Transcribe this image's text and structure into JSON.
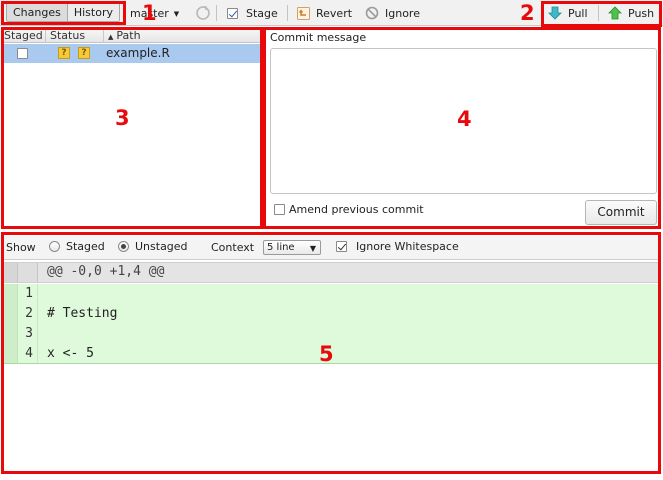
{
  "toolbar": {
    "tabs": [
      {
        "label": "Changes"
      },
      {
        "label": "History"
      }
    ],
    "branch": "master",
    "stage_label": "Stage",
    "revert_label": "Revert",
    "ignore_label": "Ignore",
    "pull_label": "Pull",
    "push_label": "Push"
  },
  "files": {
    "columns": {
      "staged": "Staged",
      "status": "Status",
      "path": "Path"
    },
    "rows": [
      {
        "staged": false,
        "status": [
          "?",
          "?"
        ],
        "path": "example.R"
      }
    ]
  },
  "commit": {
    "label": "Commit message",
    "message": "",
    "amend_label": "Amend previous commit",
    "button_label": "Commit"
  },
  "diff_options": {
    "show_label": "Show",
    "staged_label": "Staged",
    "unstaged_label": "Unstaged",
    "selected_view": "Unstaged",
    "context_label": "Context",
    "context_value": "5 line",
    "ignore_whitespace_label": "Ignore Whitespace",
    "ignore_whitespace_checked": true
  },
  "diff": {
    "hunk_header": "@@ -0,0 +1,4 @@",
    "lines": [
      {
        "num": "1",
        "text": ""
      },
      {
        "num": "2",
        "text": "# Testing"
      },
      {
        "num": "3",
        "text": ""
      },
      {
        "num": "4",
        "text": "x <- 5"
      }
    ]
  },
  "annotations": {
    "labels": [
      "1",
      "2",
      "3",
      "4",
      "5"
    ],
    "color": "#e8090b"
  },
  "colors": {
    "selected_row": "#a9c9ef",
    "added_line": "#dffadb",
    "annotation": "#e8090b"
  }
}
